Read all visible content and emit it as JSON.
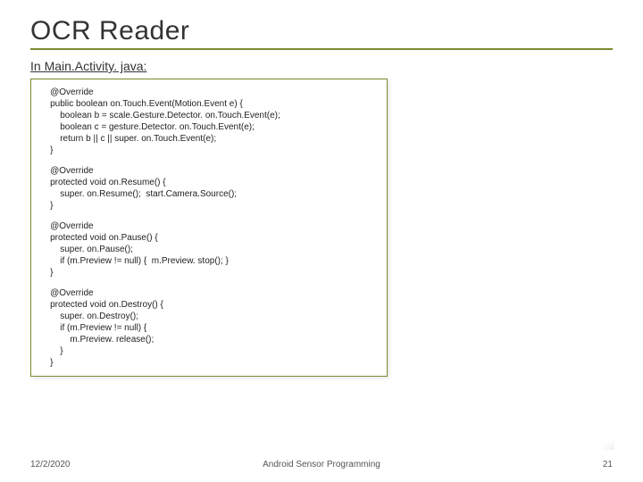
{
  "title": "OCR Reader",
  "subtitle": "In Main.Activity. java:",
  "code_blocks": [
    "    @Override\n    public boolean on.Touch.Event(Motion.Event e) {\n        boolean b = scale.Gesture.Detector. on.Touch.Event(e);\n        boolean c = gesture.Detector. on.Touch.Event(e);\n        return b || c || super. on.Touch.Event(e);\n    }",
    "    @Override\n    protected void on.Resume() {\n        super. on.Resume();  start.Camera.Source();\n    }",
    "    @Override\n    protected void on.Pause() {\n        super. on.Pause();\n        if (m.Preview != null) {  m.Preview. stop(); }\n    }",
    "    @Override\n    protected void on.Destroy() {\n        super. on.Destroy();\n        if (m.Preview != null) {\n            m.Preview. release();\n        }\n    }"
  ],
  "footer": {
    "date": "12/2/2020",
    "center": "Android Sensor Programming",
    "page": "21"
  }
}
